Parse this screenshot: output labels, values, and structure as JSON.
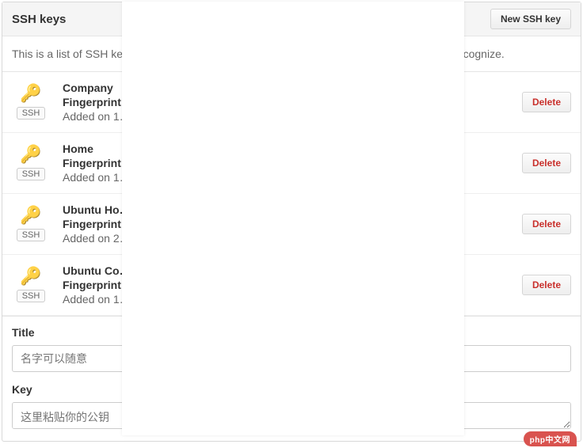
{
  "header": {
    "title": "SSH keys",
    "new_button": "New SSH key"
  },
  "description": "This is a list of SSH keys associated with your account. Remove any keys that you do not recognize.",
  "ssh_badge_label": "SSH",
  "delete_label": "Delete",
  "fingerprint_label": "Fingerprint",
  "keys": [
    {
      "name": "Company",
      "fingerprint": "",
      "added": "Added on 1…"
    },
    {
      "name": "Home",
      "fingerprint": "",
      "added": "Added on 1…"
    },
    {
      "name": "Ubuntu Ho…",
      "fingerprint": "",
      "added": "Added on 2…"
    },
    {
      "name": "Ubuntu Co…",
      "fingerprint": "",
      "added": "Added on 1…"
    }
  ],
  "form": {
    "title_label": "Title",
    "title_placeholder": "名字可以随意",
    "key_label": "Key",
    "key_placeholder": "这里粘贴你的公钥"
  },
  "footer_logo": "php中文网"
}
